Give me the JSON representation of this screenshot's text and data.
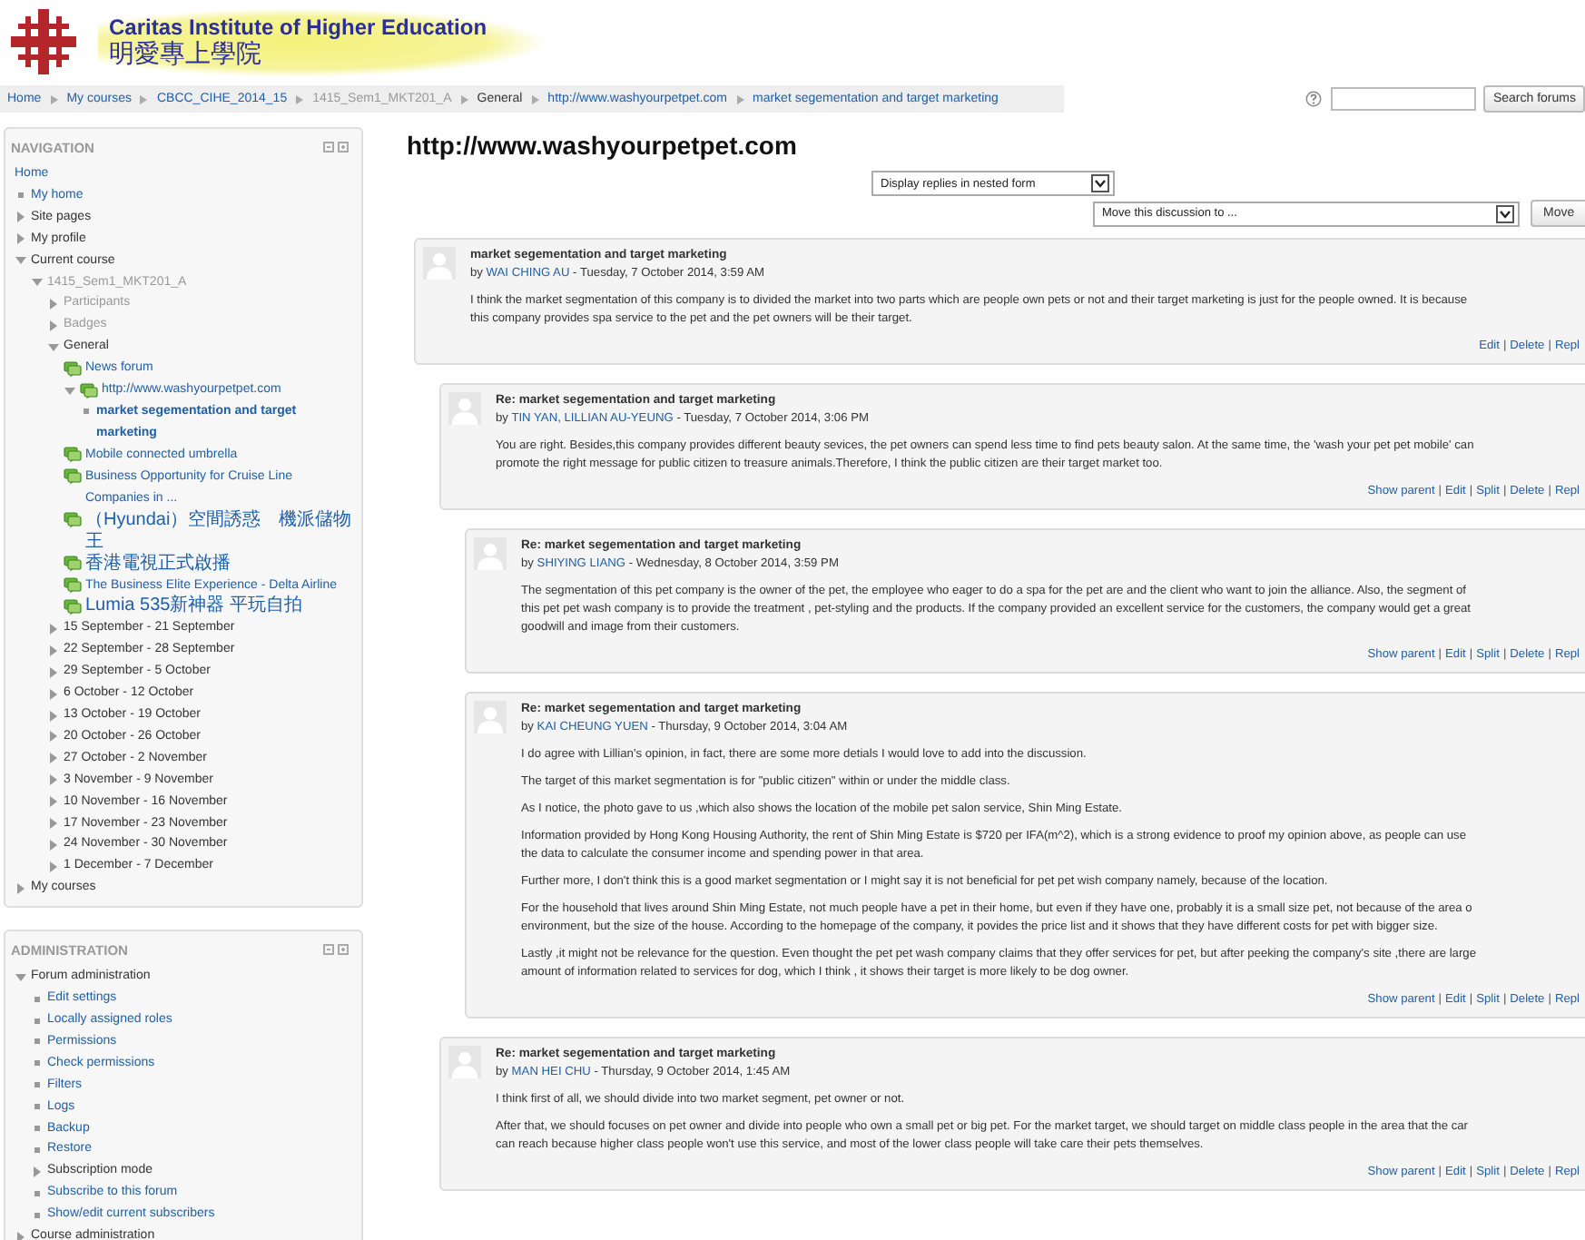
{
  "header": {
    "name_en": "Caritas Institute of Higher Education",
    "name_zh": "明愛專上學院"
  },
  "breadcrumb": [
    {
      "label": "Home",
      "kind": "link"
    },
    {
      "label": "My courses",
      "kind": "link"
    },
    {
      "label": "CBCC_CIHE_2014_15",
      "kind": "link"
    },
    {
      "label": "1415_Sem1_MKT201_A",
      "kind": "dimmed"
    },
    {
      "label": "General",
      "kind": "text"
    },
    {
      "label": "http://www.washyourpetpet.com",
      "kind": "link"
    },
    {
      "label": "market segementation and target marketing",
      "kind": "link"
    }
  ],
  "search": {
    "button": "Search forums"
  },
  "navigation": {
    "title": "NAVIGATION",
    "items": [
      {
        "label": "Home",
        "kind": "root"
      },
      {
        "label": "My home",
        "kind": "leaf"
      },
      {
        "label": "Site pages",
        "kind": "branch",
        "expanded": false
      },
      {
        "label": "My profile",
        "kind": "branch",
        "expanded": false
      },
      {
        "label": "Current course",
        "kind": "branch",
        "expanded": true,
        "children": [
          {
            "label": "1415_Sem1_MKT201_A",
            "kind": "branch",
            "expanded": true,
            "dimmed": true,
            "children": [
              {
                "label": "Participants",
                "kind": "branch",
                "expanded": false,
                "dimmed": true
              },
              {
                "label": "Badges",
                "kind": "branch",
                "expanded": false,
                "dimmed": true
              },
              {
                "label": "General",
                "kind": "branch",
                "expanded": true,
                "dimmed": false,
                "children": [
                  {
                    "label": "News forum",
                    "kind": "forum"
                  },
                  {
                    "label": "http://www.washyourpetpet.com",
                    "kind": "forum",
                    "expanded": true,
                    "children": [
                      {
                        "label": "market segementation and target marketing",
                        "kind": "leaf",
                        "active": true
                      }
                    ]
                  },
                  {
                    "label": "Mobile connected umbrella",
                    "kind": "forum"
                  },
                  {
                    "label": "Business Opportunity for Cruise Line Companies in ...",
                    "kind": "forum"
                  },
                  {
                    "label": "（Hyundai）空間誘惑　機派儲物王",
                    "kind": "forum"
                  },
                  {
                    "label": "香港電視正式啟播",
                    "kind": "forum"
                  },
                  {
                    "label": "The Business Elite Experience - Delta Airline",
                    "kind": "forum"
                  },
                  {
                    "label": "Lumia 535新神器 平玩自拍",
                    "kind": "forum"
                  }
                ]
              },
              {
                "label": "15 September - 21 September",
                "kind": "branch",
                "expanded": false,
                "dimmed": false
              },
              {
                "label": "22 September - 28 September",
                "kind": "branch",
                "expanded": false,
                "dimmed": false
              },
              {
                "label": "29 September - 5 October",
                "kind": "branch",
                "expanded": false,
                "dimmed": false
              },
              {
                "label": "6 October - 12 October",
                "kind": "branch",
                "expanded": false,
                "dimmed": false
              },
              {
                "label": "13 October - 19 October",
                "kind": "branch",
                "expanded": false,
                "dimmed": false
              },
              {
                "label": "20 October - 26 October",
                "kind": "branch",
                "expanded": false,
                "dimmed": false
              },
              {
                "label": "27 October - 2 November",
                "kind": "branch",
                "expanded": false,
                "dimmed": false
              },
              {
                "label": "3 November - 9 November",
                "kind": "branch",
                "expanded": false,
                "dimmed": false
              },
              {
                "label": "10 November - 16 November",
                "kind": "branch",
                "expanded": false,
                "dimmed": false
              },
              {
                "label": "17 November - 23 November",
                "kind": "branch",
                "expanded": false,
                "dimmed": false
              },
              {
                "label": "24 November - 30 November",
                "kind": "branch",
                "expanded": false,
                "dimmed": false
              },
              {
                "label": "1 December - 7 December",
                "kind": "branch",
                "expanded": false,
                "dimmed": false
              }
            ]
          }
        ]
      },
      {
        "label": "My courses",
        "kind": "branch",
        "expanded": false
      }
    ]
  },
  "administration": {
    "title": "ADMINISTRATION",
    "items": [
      {
        "label": "Forum administration",
        "kind": "branch",
        "expanded": true,
        "children": [
          {
            "label": "Edit settings",
            "kind": "leaf"
          },
          {
            "label": "Locally assigned roles",
            "kind": "leaf"
          },
          {
            "label": "Permissions",
            "kind": "leaf"
          },
          {
            "label": "Check permissions",
            "kind": "leaf"
          },
          {
            "label": "Filters",
            "kind": "leaf"
          },
          {
            "label": "Logs",
            "kind": "leaf"
          },
          {
            "label": "Backup",
            "kind": "leaf"
          },
          {
            "label": "Restore",
            "kind": "leaf"
          },
          {
            "label": "Subscription mode",
            "kind": "branch",
            "expanded": false
          },
          {
            "label": "Subscribe to this forum",
            "kind": "leaf"
          },
          {
            "label": "Show/edit current subscribers",
            "kind": "leaf"
          }
        ]
      },
      {
        "label": "Course administration",
        "kind": "branch",
        "expanded": false
      }
    ]
  },
  "discussion": {
    "title": "http://www.washyourpetpet.com",
    "display_mode": "Display replies in nested form",
    "move_to": "Move this discussion to ...",
    "move_button": "Move",
    "action_separator": "|"
  },
  "posts": [
    {
      "subject": "market segementation and target marketing",
      "by": "by",
      "author": "WAI CHING AU",
      "date": "- Tuesday, 7 October 2014, 3:59 AM",
      "paragraphs": [
        "I think the market segmentation of this company is to divided the market into two parts which are people own pets or not and their target marketing is just for the people owned. It is because\nthis company provides spa service to the pet and the pet owners will be their target."
      ],
      "actions": [
        "Edit",
        "Delete",
        "Repl"
      ],
      "children": [
        {
          "subject": "Re: market segementation and target marketing",
          "by": "by",
          "author": "TIN YAN, LILLIAN AU-YEUNG",
          "date": "- Tuesday, 7 October 2014, 3:06 PM",
          "paragraphs": [
            "You are right. Besides,this company provides different beauty sevices, the pet owners can spend less time to find pets beauty salon. At the same time, the 'wash your pet pet mobile' can\npromote the right message for public citizen to treasure animals.Therefore, I think the public citizen are their target market too."
          ],
          "actions": [
            "Show parent",
            "Edit",
            "Split",
            "Delete",
            "Repl"
          ],
          "children": [
            {
              "subject": "Re: market segementation and target marketing",
              "by": "by",
              "author": "SHIYING LIANG",
              "date": "- Wednesday, 8 October 2014, 3:59 PM",
              "paragraphs": [
                "The segmentation  of  this pet company is  the owner of the pet, the employee who eager to do a spa for the pet are and the client who want to join the alliance. Also, the segment of\nthis pet pet wash company is to provide the treatment , pet-styling and the products. If the company provided an excellent service for the customers, the company would get a great\ngoodwill and image from their customers."
              ],
              "actions": [
                "Show parent",
                "Edit",
                "Split",
                "Delete",
                "Repl"
              ]
            },
            {
              "subject": "Re: market segementation and target marketing",
              "by": "by",
              "author": "KAI CHEUNG YUEN",
              "date": "- Thursday, 9 October 2014, 3:04 AM",
              "paragraphs": [
                "I do agree with Lillian's opinion, in fact, there are some more detials I would love to add into the discussion.",
                "The target of this market segmentation is for \"public citizen\" within  or under the middle class.",
                " As I notice, the photo gave to us ,which also shows the location of the mobile pet salon service, Shin Ming Estate.",
                "Information provided by Hong Kong Housing Authority, the rent of Shin Ming Estate is $720 per IFA(m^2), which is a strong evidence to proof my opinion above, as people can use\nthe data to calculate  the consumer income and spending power in that area.",
                "Further more, I don't think this is a good market segmentation or I might say it is not beneficial for pet pet wish company namely, because of the location.",
                " For the household that lives around Shin Ming Estate, not much people have a  pet in their home, but even if they have one, probably it is a small size pet, not because of the area o\nenvironment, but the size of the house. According to the homepage of the company, it povides the price list and it shows that they have different costs for pet with bigger size.",
                "Lastly ,it might not be relevance for the question.  Even thought the pet pet wash company claims that they offer services for pet, but after peeking the company's site ,there are large\namount of information related to services for dog, which I think , it shows their target is more likely to be dog owner."
              ],
              "actions": [
                "Show parent",
                "Edit",
                "Split",
                "Delete",
                "Repl"
              ]
            }
          ]
        },
        {
          "subject": "Re: market segementation and target marketing",
          "by": "by",
          "author": "MAN HEI CHU",
          "date": "- Thursday, 9 October 2014, 1:45 AM",
          "paragraphs": [
            "I think first of all, we should divide into two market segment, pet owner or not.",
            "After that, we should focuses on pet owner and divide into people who own a small pet or big pet. For the market target, we should target on middle class people in the area that the car\ncan reach because higher class people won't use this service, and most of the lower class people will take care their pets themselves."
          ],
          "actions": [
            "Show parent",
            "Edit",
            "Split",
            "Delete",
            "Repl"
          ]
        }
      ]
    }
  ]
}
